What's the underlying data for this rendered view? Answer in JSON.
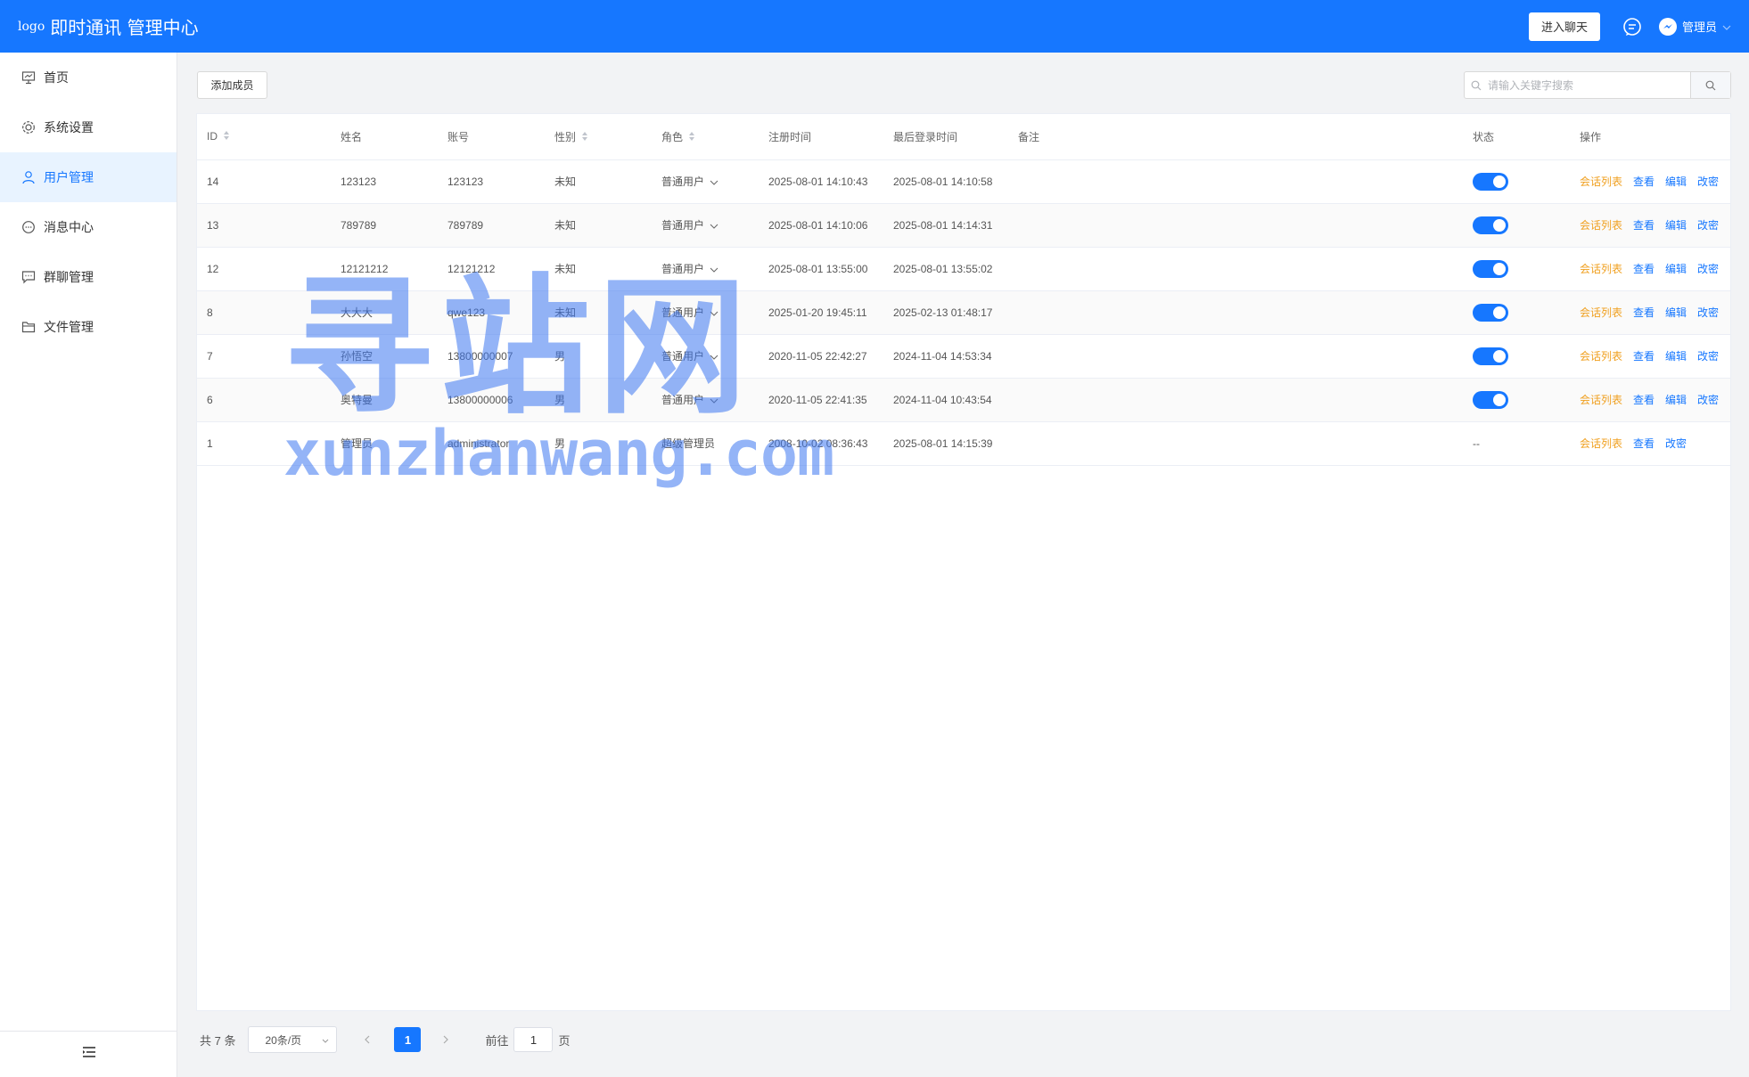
{
  "header": {
    "logo_alt": "logo",
    "title": "即时通讯 管理中心",
    "enter_chat_label": "进入聊天",
    "user_name": "管理员"
  },
  "sidebar": {
    "items": [
      {
        "label": "首页",
        "icon": "presentation-icon"
      },
      {
        "label": "系统设置",
        "icon": "gear-icon"
      },
      {
        "label": "用户管理",
        "icon": "user-icon"
      },
      {
        "label": "消息中心",
        "icon": "chat-bubble-icon"
      },
      {
        "label": "群聊管理",
        "icon": "message-square-icon"
      },
      {
        "label": "文件管理",
        "icon": "folder-icon"
      }
    ],
    "active_index": 2
  },
  "toolbar": {
    "add_member_label": "添加成员",
    "search_placeholder": "请输入关键字搜索"
  },
  "table": {
    "columns": [
      "ID",
      "姓名",
      "账号",
      "性别",
      "角色",
      "注册时间",
      "最后登录时间",
      "备注",
      "状态",
      "操作"
    ],
    "rows": [
      {
        "id": "14",
        "name": "123123",
        "account": "123123",
        "gender": "未知",
        "role": "普通用户",
        "registered": "2025-08-01 14:10:43",
        "last_login": "2025-08-01 14:10:58",
        "note": "",
        "status": "on",
        "status_text": "",
        "ops": [
          "会话列表",
          "查看",
          "编辑",
          "改密"
        ]
      },
      {
        "id": "13",
        "name": "789789",
        "account": "789789",
        "gender": "未知",
        "role": "普通用户",
        "registered": "2025-08-01 14:10:06",
        "last_login": "2025-08-01 14:14:31",
        "note": "",
        "status": "on",
        "status_text": "",
        "ops": [
          "会话列表",
          "查看",
          "编辑",
          "改密"
        ]
      },
      {
        "id": "12",
        "name": "12121212",
        "account": "12121212",
        "gender": "未知",
        "role": "普通用户",
        "registered": "2025-08-01 13:55:00",
        "last_login": "2025-08-01 13:55:02",
        "note": "",
        "status": "on",
        "status_text": "",
        "ops": [
          "会话列表",
          "查看",
          "编辑",
          "改密"
        ]
      },
      {
        "id": "8",
        "name": "大大大",
        "account": "qwe123",
        "gender": "未知",
        "role": "普通用户",
        "registered": "2025-01-20 19:45:11",
        "last_login": "2025-02-13 01:48:17",
        "note": "",
        "status": "on",
        "status_text": "",
        "ops": [
          "会话列表",
          "查看",
          "编辑",
          "改密"
        ]
      },
      {
        "id": "7",
        "name": "孙悟空",
        "account": "13800000007",
        "gender": "男",
        "role": "普通用户",
        "registered": "2020-11-05 22:42:27",
        "last_login": "2024-11-04 14:53:34",
        "note": "",
        "status": "on",
        "status_text": "",
        "ops": [
          "会话列表",
          "查看",
          "编辑",
          "改密"
        ]
      },
      {
        "id": "6",
        "name": "奥特曼",
        "account": "13800000006",
        "gender": "男",
        "role": "普通用户",
        "registered": "2020-11-05 22:41:35",
        "last_login": "2024-11-04 10:43:54",
        "note": "",
        "status": "on",
        "status_text": "",
        "ops": [
          "会话列表",
          "查看",
          "编辑",
          "改密"
        ]
      },
      {
        "id": "1",
        "name": "管理员",
        "account": "administrator",
        "gender": "男",
        "role": "超级管理员",
        "registered": "2008-10-02 08:36:43",
        "last_login": "2025-08-01 14:15:39",
        "note": "",
        "status": "none",
        "status_text": "--",
        "ops": [
          "会话列表",
          "查看",
          "改密"
        ]
      }
    ]
  },
  "pagination": {
    "total_text": "共 7 条",
    "page_size": "20条/页",
    "current_page": "1",
    "goto_label": "前往",
    "goto_value": "1",
    "goto_suffix": "页"
  },
  "watermark": {
    "main": "寻站网",
    "sub": "xunzhanwang.com"
  },
  "colors": {
    "primary": "#1677ff",
    "warning_link": "#f0a020"
  }
}
